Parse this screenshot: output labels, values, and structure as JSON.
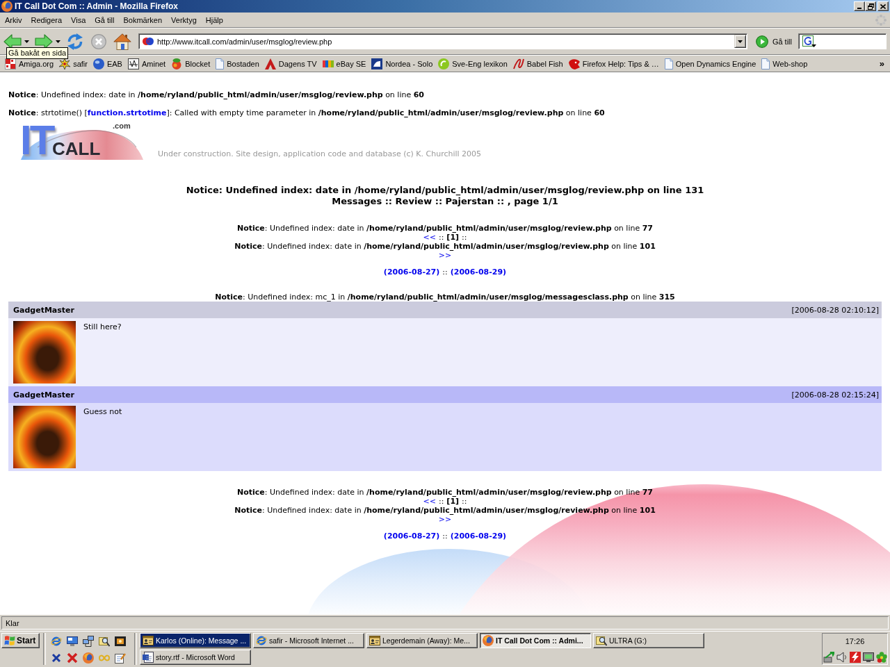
{
  "window": {
    "title": "IT Call Dot Com :: Admin - Mozilla Firefox"
  },
  "menu": [
    "Arkiv",
    "Redigera",
    "Visa",
    "Gå till",
    "Bokmärken",
    "Verktyg",
    "Hjälp"
  ],
  "toolbar": {
    "buttons": [
      {
        "kind": "back",
        "disabled": false
      },
      {
        "kind": "forward",
        "disabled": false
      },
      {
        "kind": "reload",
        "disabled": false
      },
      {
        "kind": "stop",
        "disabled": true
      },
      {
        "kind": "home",
        "disabled": false
      }
    ],
    "address": "http://www.itcall.com/admin/user/msglog/review.php",
    "go_label": "Gå till"
  },
  "tooltip": "Gå bakåt en sida",
  "bookmarks": [
    {
      "label": "Amiga.org",
      "kind": "checker"
    },
    {
      "label": "safir",
      "kind": "burst"
    },
    {
      "label": "EAB",
      "kind": "globe"
    },
    {
      "label": "Aminet",
      "kind": "sketch"
    },
    {
      "label": "Blocket",
      "kind": "fruit"
    },
    {
      "label": "Bostaden",
      "kind": "page"
    },
    {
      "label": "Dagens TV",
      "kind": "arrowhead"
    },
    {
      "label": "eBay SE",
      "kind": "tiles"
    },
    {
      "label": "Nordea - Solo",
      "kind": "square"
    },
    {
      "label": "Sve-Eng lexikon",
      "kind": "swirl"
    },
    {
      "label": "Babel Fish",
      "kind": "script"
    },
    {
      "label": "Firefox Help: Tips & …",
      "kind": "head"
    },
    {
      "label": "Open Dynamics Engine",
      "kind": "page"
    },
    {
      "label": "Web-shop",
      "kind": "page"
    }
  ],
  "bookmarks_overflow": "»",
  "page": {
    "notice_top": "**Notice**: Undefined index: date in **/home/ryland/public_html/admin/user/msglog/review.php** on line **60**",
    "strtotime_notice": {
      "before": "**Notice**: strtotime() [",
      "link": "function.strtotime",
      "after": "]: Called with empty time parameter in **/home/ryland/public_html/admin/user/msglog/review.php** on line **60**"
    },
    "logo": {
      "letters": "IT",
      "word": "CALL",
      "suffix": ".com"
    },
    "tagline": "Under construction. Site design, application code and database (c) K. Churchill 2005",
    "heading": {
      "notice": "Notice: Undefined index: date in /home/ryland/public_html/admin/user/msglog/review.php on line 131",
      "title": "Messages :: Review :: Pajerstan :: , page 1/1"
    },
    "pager_top": {
      "notice_before": "**Notice**: Undefined index: date in **/home/ryland/public_html/admin/user/msglog/review.php** on line **77**",
      "prev": "<<",
      "separator_left": "::",
      "pages": [
        {
          "label": "[1]",
          "selected": true
        }
      ],
      "separator_right": "::",
      "notice_after": "**Notice**: Undefined index: date in **/home/ryland/public_html/admin/user/msglog/review.php** on line **101**",
      "next": ">>",
      "date_from": "(2006-08-27)",
      "date_separator": "::",
      "date_to": "(2006-08-29)"
    },
    "list_notice": "**Notice**: Undefined index: mc_1 in **/home/ryland/public_html/admin/user/msglog/messagesclass.php** on line **315**",
    "messages": [
      {
        "author": "GadgetMaster",
        "time": "[2006-08-28 02:10:12]",
        "text": "Still here?"
      },
      {
        "author": "GadgetMaster",
        "time": "[2006-08-28 02:15:24]",
        "text": "Guess not"
      }
    ],
    "pager_bottom": {
      "notice_before": "**Notice**: Undefined index: date in **/home/ryland/public_html/admin/user/msglog/review.php** on line **77**",
      "prev": "<<",
      "separator_left": "::",
      "pages": [
        {
          "label": "[1]",
          "selected": true
        }
      ],
      "separator_right": "::",
      "notice_after": "**Notice**: Undefined index: date in **/home/ryland/public_html/admin/user/msglog/review.php** on line **101**",
      "next": ">>",
      "date_from": "(2006-08-27)",
      "date_separator": "::",
      "date_to": "(2006-08-29)"
    }
  },
  "status_bar": {
    "text": "Klar"
  },
  "taskbar": {
    "start": "Start",
    "tasks": [
      {
        "label": "Karlos (Online): Message ...",
        "kind": "chat",
        "selected": false,
        "flashing": true
      },
      {
        "label": "safir - Microsoft Internet ...",
        "kind": "explorer",
        "selected": false,
        "flashing": false
      },
      {
        "label": "Legerdemain (Away): Me...",
        "kind": "chat",
        "selected": false,
        "flashing": false
      },
      {
        "label": "IT Call Dot Com :: Admi...",
        "kind": "firefox",
        "selected": true,
        "flashing": false
      },
      {
        "label": "ULTRA (G:)",
        "kind": "search",
        "selected": false,
        "flashing": false
      },
      {
        "label": "story.rtf - Microsoft Word",
        "kind": "word",
        "selected": false,
        "flashing": false
      }
    ],
    "clock": "17:26"
  }
}
